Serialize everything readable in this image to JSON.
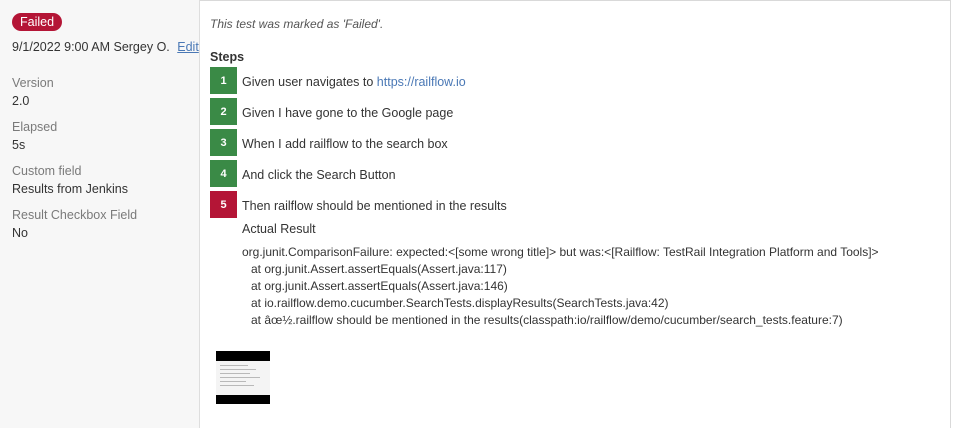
{
  "result": {
    "status": "Failed",
    "datetime": "9/1/2022 9:00 AM",
    "author": "Sergey O.",
    "edit_label": "Edit",
    "fields": [
      {
        "label": "Version",
        "value": "2.0"
      },
      {
        "label": "Elapsed",
        "value": "5s"
      },
      {
        "label": "Custom field",
        "value": "Results from Jenkins"
      },
      {
        "label": "Result Checkbox Field",
        "value": "No"
      }
    ]
  },
  "comment": "This test was marked as 'Failed'.",
  "steps_title": "Steps",
  "steps": [
    {
      "number": "1",
      "prefix": "Given user navigates to ",
      "link": "https://railflow.io",
      "status": "passed"
    },
    {
      "number": "2",
      "text": "Given I have gone to the Google page",
      "status": "passed"
    },
    {
      "number": "3",
      "text": "When I add railflow to the search box",
      "status": "passed"
    },
    {
      "number": "4",
      "text": "And click the Search Button",
      "status": "passed"
    },
    {
      "number": "5",
      "text": "Then railflow should be mentioned in the results",
      "status": "failed"
    }
  ],
  "actual_result_label": "Actual Result",
  "stack_trace": [
    "org.junit.ComparisonFailure: expected:<[some wrong title]> but was:<[Railflow: TestRail Integration Platform and Tools]>",
    "at org.junit.Assert.assertEquals(Assert.java:117)",
    "at org.junit.Assert.assertEquals(Assert.java:146)",
    "at io.railflow.demo.cucumber.SearchTests.displayResults(SearchTests.java:42)",
    "at âœ½.railflow should be mentioned in the results(classpath:io/railflow/demo/cucumber/search_tests.feature:7)"
  ],
  "colors": {
    "passed": "#3a8a46",
    "failed": "#b41536",
    "link": "#4a78b5"
  }
}
